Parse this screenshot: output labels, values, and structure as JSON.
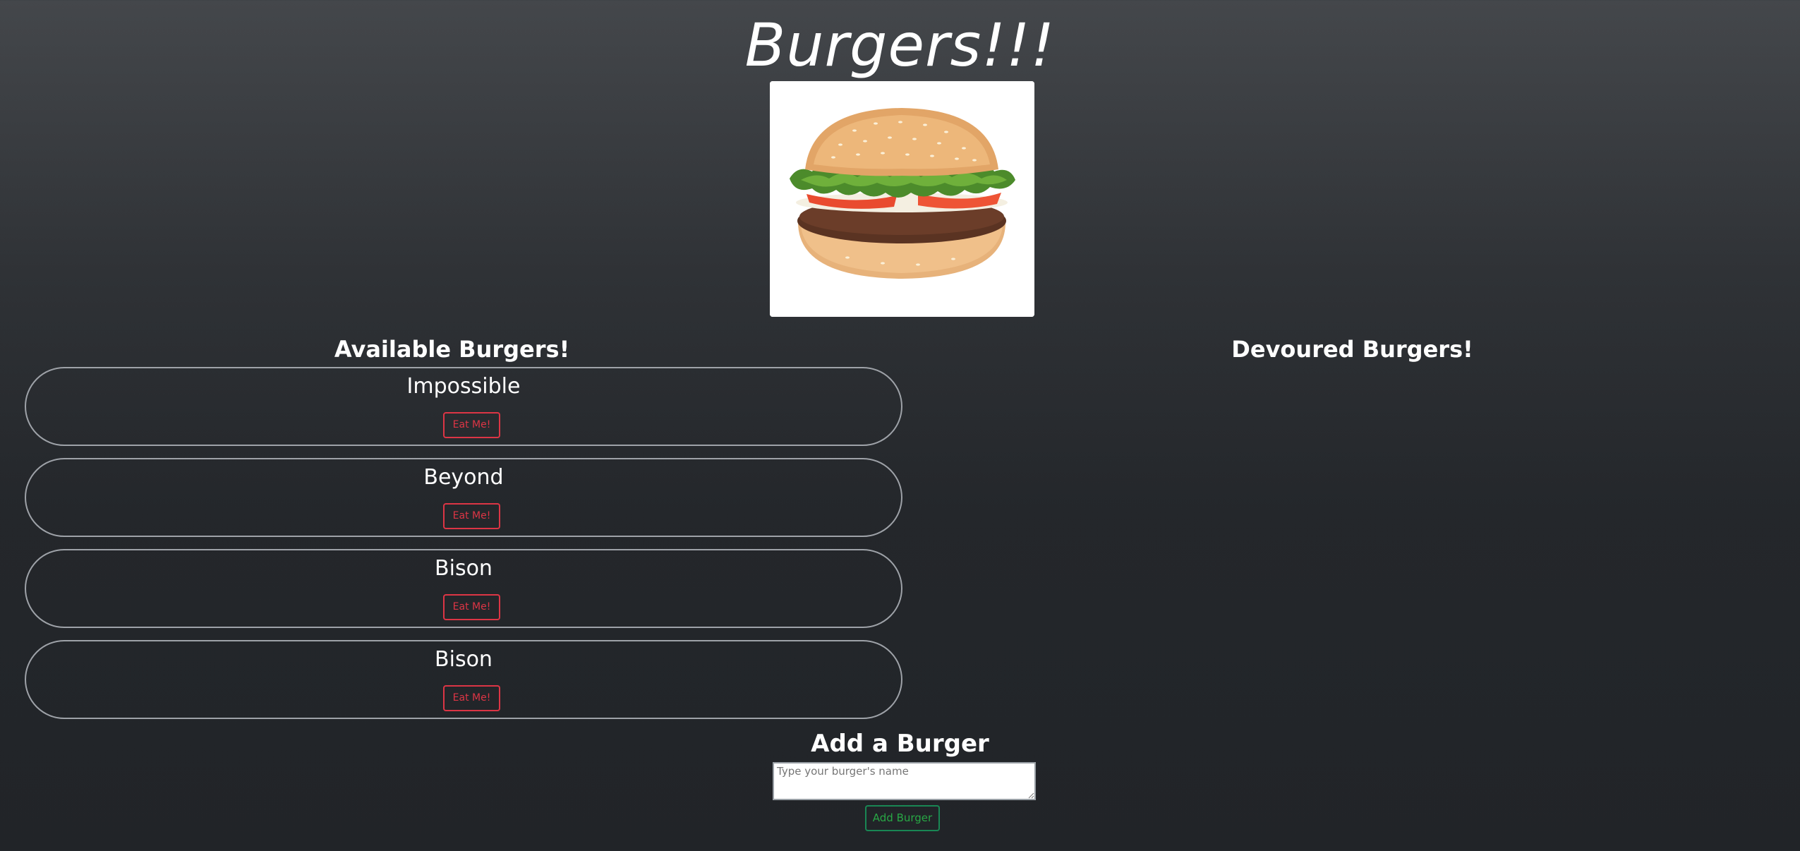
{
  "header": {
    "title": "Burgers!!!"
  },
  "hero": {
    "image_name": "burger-image"
  },
  "available": {
    "heading": "Available Burgers!",
    "items": [
      {
        "name": "Impossible",
        "button_label": "Eat Me!"
      },
      {
        "name": "Beyond",
        "button_label": "Eat Me!"
      },
      {
        "name": "Bison",
        "button_label": "Eat Me!"
      },
      {
        "name": "Bison",
        "button_label": "Eat Me!"
      }
    ]
  },
  "devoured": {
    "heading": "Devoured Burgers!",
    "items": []
  },
  "add_form": {
    "heading": "Add a Burger",
    "placeholder": "Type your burger's name",
    "value": "",
    "submit_label": "Add Burger"
  },
  "colors": {
    "eat_button": "#dc3545",
    "add_button": "#198754",
    "card_border": "#9ea2a8"
  }
}
